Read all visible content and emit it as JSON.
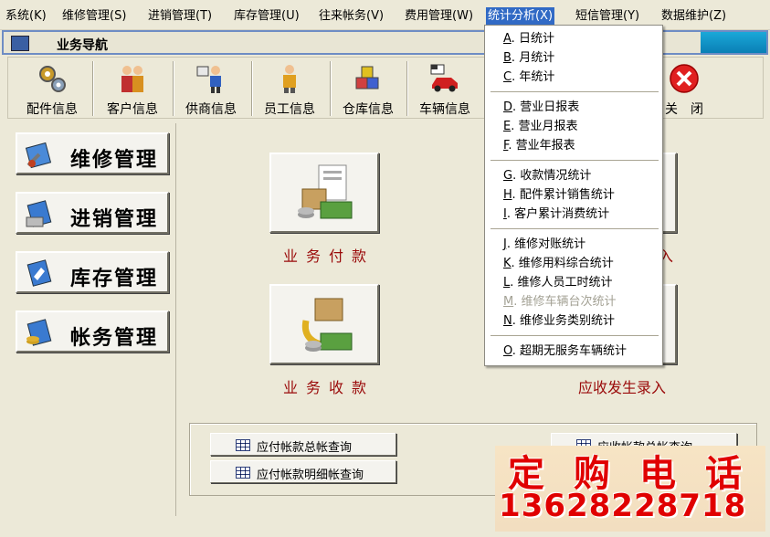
{
  "menubar": {
    "items": [
      {
        "label": "系统",
        "key": "(K)"
      },
      {
        "label": "维修管理",
        "key": "(S)"
      },
      {
        "label": "进销管理",
        "key": "(T)"
      },
      {
        "label": "库存管理",
        "key": "(U)"
      },
      {
        "label": "往来帐务",
        "key": "(V)"
      },
      {
        "label": "费用管理",
        "key": "(W)"
      },
      {
        "label": "统计分析",
        "key": "(X)"
      },
      {
        "label": "短信管理",
        "key": "(Y)"
      },
      {
        "label": "数据维护",
        "key": "(Z)"
      }
    ]
  },
  "window": {
    "title": "业务导航"
  },
  "toolbar": {
    "items": [
      {
        "label": "配件信息",
        "icon": "gears-icon"
      },
      {
        "label": "客户信息",
        "icon": "people-icon"
      },
      {
        "label": "供商信息",
        "icon": "supplier-icon"
      },
      {
        "label": "员工信息",
        "icon": "employee-icon"
      },
      {
        "label": "仓库信息",
        "icon": "warehouse-icon"
      },
      {
        "label": "车辆信息",
        "icon": "car-icon"
      },
      {
        "label": "关　闭",
        "icon": "close-icon"
      }
    ]
  },
  "nav": {
    "items": [
      {
        "label": "维修管理",
        "icon": "repair-tools-icon"
      },
      {
        "label": "进销管理",
        "icon": "purchase-sales-icon"
      },
      {
        "label": "库存管理",
        "icon": "inventory-icon"
      },
      {
        "label": "帐务管理",
        "icon": "accounts-icon"
      }
    ]
  },
  "main": {
    "pay_label": "业务付款",
    "receive_label": "业务收款",
    "receivable_entry_label": "应收发生录入",
    "partial_label_right": "入",
    "query": {
      "payable_summary": "应付帐款总帐查询",
      "payable_detail": "应付帐款明细帐查询",
      "receivable_summary": "应收帐款总帐查询"
    }
  },
  "dropdown": {
    "groups": [
      [
        {
          "key": "A",
          "label": "日统计",
          "enabled": true
        },
        {
          "key": "B",
          "label": "月统计",
          "enabled": true
        },
        {
          "key": "C",
          "label": "年统计",
          "enabled": true
        }
      ],
      [
        {
          "key": "D",
          "label": "营业日报表",
          "enabled": true
        },
        {
          "key": "E",
          "label": "营业月报表",
          "enabled": true
        },
        {
          "key": "F",
          "label": "营业年报表",
          "enabled": true
        }
      ],
      [
        {
          "key": "G",
          "label": "收款情况统计",
          "enabled": true
        },
        {
          "key": "H",
          "label": "配件累计销售统计",
          "enabled": true
        },
        {
          "key": "I",
          "label": "客户累计消费统计",
          "enabled": true
        }
      ],
      [
        {
          "key": "J",
          "label": "维修对账统计",
          "enabled": true
        },
        {
          "key": "K",
          "label": "维修用料综合统计",
          "enabled": true
        },
        {
          "key": "L",
          "label": "维修人员工时统计",
          "enabled": true
        },
        {
          "key": "M",
          "label": "维修车辆台次统计",
          "enabled": false
        },
        {
          "key": "N",
          "label": "维修业务类别统计",
          "enabled": true
        }
      ],
      [
        {
          "key": "O",
          "label": "超期无服务车辆统计",
          "enabled": true
        }
      ]
    ]
  },
  "promo": {
    "line1": "定购电话",
    "line2": "13628228718"
  },
  "colors": {
    "menu_highlight": "#316ac5",
    "label_red": "#9a0a0a",
    "promo_red": "#e00000"
  }
}
